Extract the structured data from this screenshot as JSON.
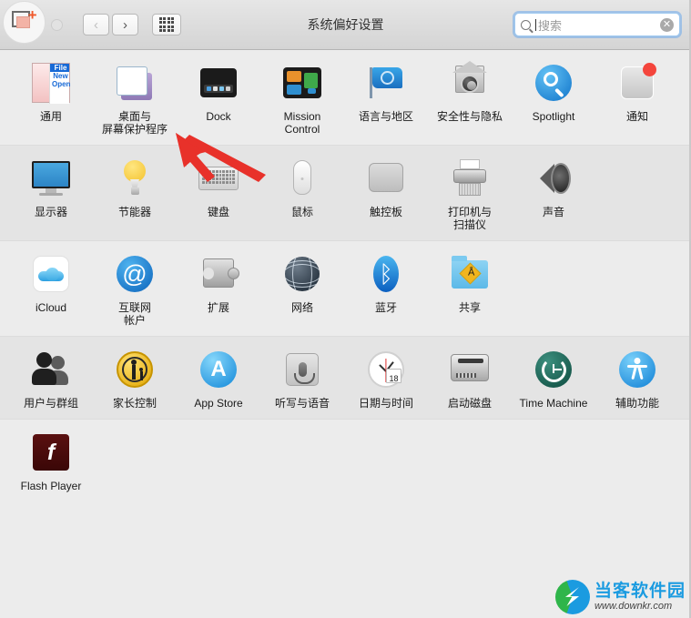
{
  "window": {
    "title": "系统偏好设置"
  },
  "toolbar": {
    "back_label": "‹",
    "forward_label": "›",
    "grid_label": "show-all-grid",
    "traffic_lights": [
      "close",
      "minimize",
      "zoom"
    ],
    "overlay_icon": "screenshot-add-icon"
  },
  "search": {
    "placeholder": "搜索",
    "value": "",
    "icon": "search-icon",
    "clear_icon": "clear-x-icon",
    "focus_color": "#6eaaeb"
  },
  "sections": [
    {
      "id": "personal",
      "items": [
        {
          "name": "general",
          "label": "通用",
          "icon": "general-icon"
        },
        {
          "name": "desktop-screensaver",
          "label": "桌面与\n屏幕保护程序",
          "icon": "desktop-screensaver-icon"
        },
        {
          "name": "dock",
          "label": "Dock",
          "icon": "dock-icon"
        },
        {
          "name": "mission-control",
          "label": "Mission\nControl",
          "icon": "mission-control-icon"
        },
        {
          "name": "language-region",
          "label": "语言与地区",
          "icon": "language-region-flag-icon"
        },
        {
          "name": "security-privacy",
          "label": "安全性与隐私",
          "icon": "security-privacy-icon"
        },
        {
          "name": "spotlight",
          "label": "Spotlight",
          "icon": "spotlight-icon"
        },
        {
          "name": "notifications",
          "label": "通知",
          "icon": "notifications-icon"
        }
      ]
    },
    {
      "id": "hardware",
      "items": [
        {
          "name": "displays",
          "label": "显示器",
          "icon": "display-icon"
        },
        {
          "name": "energy-saver",
          "label": "节能器",
          "icon": "lightbulb-icon"
        },
        {
          "name": "keyboard",
          "label": "键盘",
          "icon": "keyboard-icon"
        },
        {
          "name": "mouse",
          "label": "鼠标",
          "icon": "mouse-icon"
        },
        {
          "name": "trackpad",
          "label": "触控板",
          "icon": "trackpad-icon"
        },
        {
          "name": "printers-scanners",
          "label": "打印机与\n扫描仪",
          "icon": "printer-icon"
        },
        {
          "name": "sound",
          "label": "声音",
          "icon": "speaker-icon"
        }
      ]
    },
    {
      "id": "internet-wireless",
      "items": [
        {
          "name": "icloud",
          "label": "iCloud",
          "icon": "icloud-icon"
        },
        {
          "name": "internet-accounts",
          "label": "互联网\n帐户",
          "icon": "at-sign-icon"
        },
        {
          "name": "extensions",
          "label": "扩展",
          "icon": "puzzle-piece-icon"
        },
        {
          "name": "network",
          "label": "网络",
          "icon": "globe-icon"
        },
        {
          "name": "bluetooth",
          "label": "蓝牙",
          "icon": "bluetooth-icon"
        },
        {
          "name": "sharing",
          "label": "共享",
          "icon": "sharing-folder-icon"
        }
      ]
    },
    {
      "id": "system",
      "items": [
        {
          "name": "users-groups",
          "label": "用户与群组",
          "icon": "users-icon"
        },
        {
          "name": "parental-controls",
          "label": "家长控制",
          "icon": "parental-controls-icon"
        },
        {
          "name": "app-store",
          "label": "App Store",
          "icon": "app-store-icon"
        },
        {
          "name": "dictation-speech",
          "label": "听写与语音",
          "icon": "microphone-icon"
        },
        {
          "name": "date-time",
          "label": "日期与时间",
          "icon": "clock-icon"
        },
        {
          "name": "startup-disk",
          "label": "启动磁盘",
          "icon": "hard-disk-icon"
        },
        {
          "name": "time-machine",
          "label": "Time Machine",
          "icon": "time-machine-icon"
        },
        {
          "name": "accessibility",
          "label": "辅助功能",
          "icon": "accessibility-icon"
        }
      ]
    },
    {
      "id": "other",
      "items": [
        {
          "name": "flash-player",
          "label": "Flash Player",
          "icon": "flash-player-icon"
        }
      ]
    }
  ],
  "annotation": {
    "type": "arrow",
    "color": "#e8312a",
    "points_to": "desktop-screensaver"
  },
  "watermark": {
    "title": "当客软件园",
    "url": "www.downkr.com"
  }
}
